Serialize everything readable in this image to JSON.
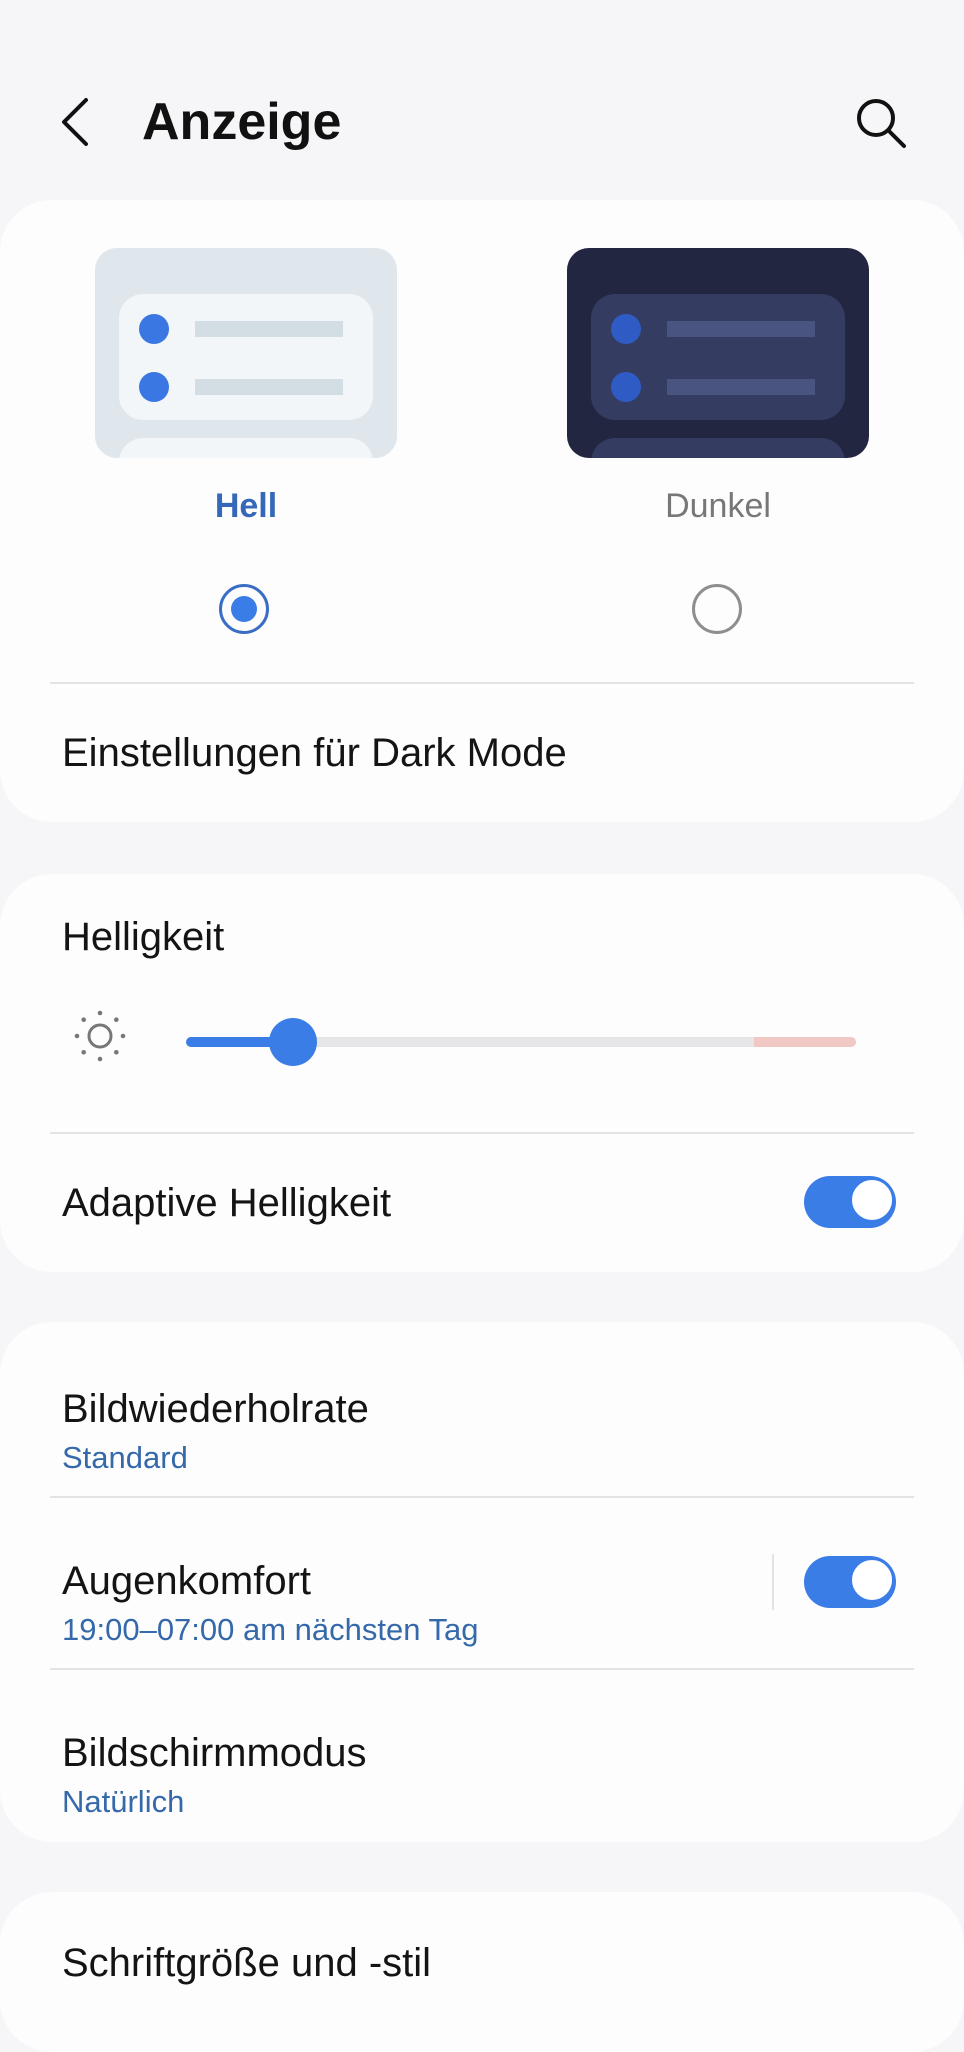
{
  "header": {
    "title": "Anzeige",
    "back_icon": "chevron-left-icon",
    "search_icon": "search-icon"
  },
  "theme": {
    "light_label": "Hell",
    "dark_label": "Dunkel",
    "selected": "Hell",
    "dark_mode_settings_label": "Einstellungen für Dark Mode"
  },
  "brightness": {
    "label": "Helligkeit",
    "icon": "sun-icon",
    "level": 0.16,
    "adaptive_label": "Adaptive Helligkeit",
    "adaptive_on": true
  },
  "display": {
    "refresh_rate_label": "Bildwiederholrate",
    "refresh_rate_value": "Standard",
    "eye_comfort_label": "Augenkomfort",
    "eye_comfort_value": "19:00–07:00 am nächsten Tag",
    "eye_comfort_on": true,
    "screen_mode_label": "Bildschirmmodus",
    "screen_mode_value": "Natürlich"
  },
  "font": {
    "label": "Schriftgröße und -stil"
  },
  "colors": {
    "accent": "#3b7de6",
    "subtext": "#3569aa",
    "background": "#f6f6f8",
    "card": "#fdfdfe"
  }
}
